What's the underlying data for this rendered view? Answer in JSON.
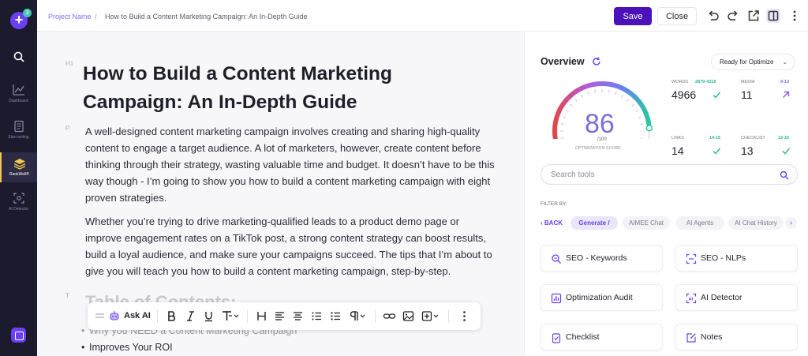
{
  "rail": {
    "badge": "3",
    "items": [
      {
        "label": "Dashboard"
      },
      {
        "label": "Start writing"
      },
      {
        "label": "RankWell®"
      },
      {
        "label": "AI Detector"
      }
    ]
  },
  "topbar": {
    "project": "Project Name",
    "separator": "/",
    "doc_title": "How to Build a Content Marketing Campaign: An In-Depth Guide",
    "save": "Save",
    "close": "Close"
  },
  "editor": {
    "h1_mark": "H1",
    "p_mark": "P",
    "t_mark": "T",
    "title": "How to Build a Content Marketing Campaign: An In-Depth Guide",
    "para1": "A well-designed content marketing campaign involves creating and sharing high-quality content to engage a target audience. A lot of marketers, however, create content before thinking through their strategy, wasting valuable time and budget. It doesn’t have to be this way though - I’m going to show you how to build a content marketing campaign with eight proven strategies.",
    "para2": "Whether you’re trying to drive marketing-qualified leads to a product demo page or improve engagement rates on a TikTok post, a strong content strategy can boost results, build a loyal audience, and make sure your campaigns succeed. The tips that I’m about to give you will teach you how to build a content marketing campaign, step-by-step.",
    "toc_heading": "Table of Contents:",
    "toc": [
      "Why you NEED a Content Marketing Campaign",
      "Improves Your ROI"
    ]
  },
  "toolbar": {
    "ask_ai": "Ask AI"
  },
  "overview": {
    "title": "Overview",
    "status": "Ready for Optimize",
    "score": "86",
    "score_max": "/100",
    "score_label": "OPTIMIZATION SCORE",
    "score_value": 86,
    "metrics": [
      {
        "label": "WORDS",
        "range": "2879-4318",
        "value": "4966",
        "range_color": "#2bb58f"
      },
      {
        "label": "MEDIA",
        "range": "9-13",
        "value": "11",
        "range_color": "#8b5cf6"
      },
      {
        "label": "LINKS",
        "range": "14-15",
        "value": "14",
        "range_color": "#2bb58f"
      },
      {
        "label": "CHECKLIST",
        "range": "12-16",
        "value": "13",
        "range_color": "#2bb58f"
      }
    ]
  },
  "tools": {
    "search_placeholder": "Search tools",
    "filter_label": "FILTER BY:",
    "back": "BACK",
    "chips": [
      "Generate /",
      "AIMEE Chat",
      "AI Agents",
      "AI Chat History"
    ],
    "items": [
      "SEO - Keywords",
      "SEO - NLPs",
      "Optimization Audit",
      "AI Detector",
      "Checklist",
      "Notes"
    ]
  },
  "colors": {
    "accent": "#6b3ff2",
    "save_button": "#4a12b8",
    "rail": "#1c1b2e",
    "success": "#2bb58f"
  }
}
